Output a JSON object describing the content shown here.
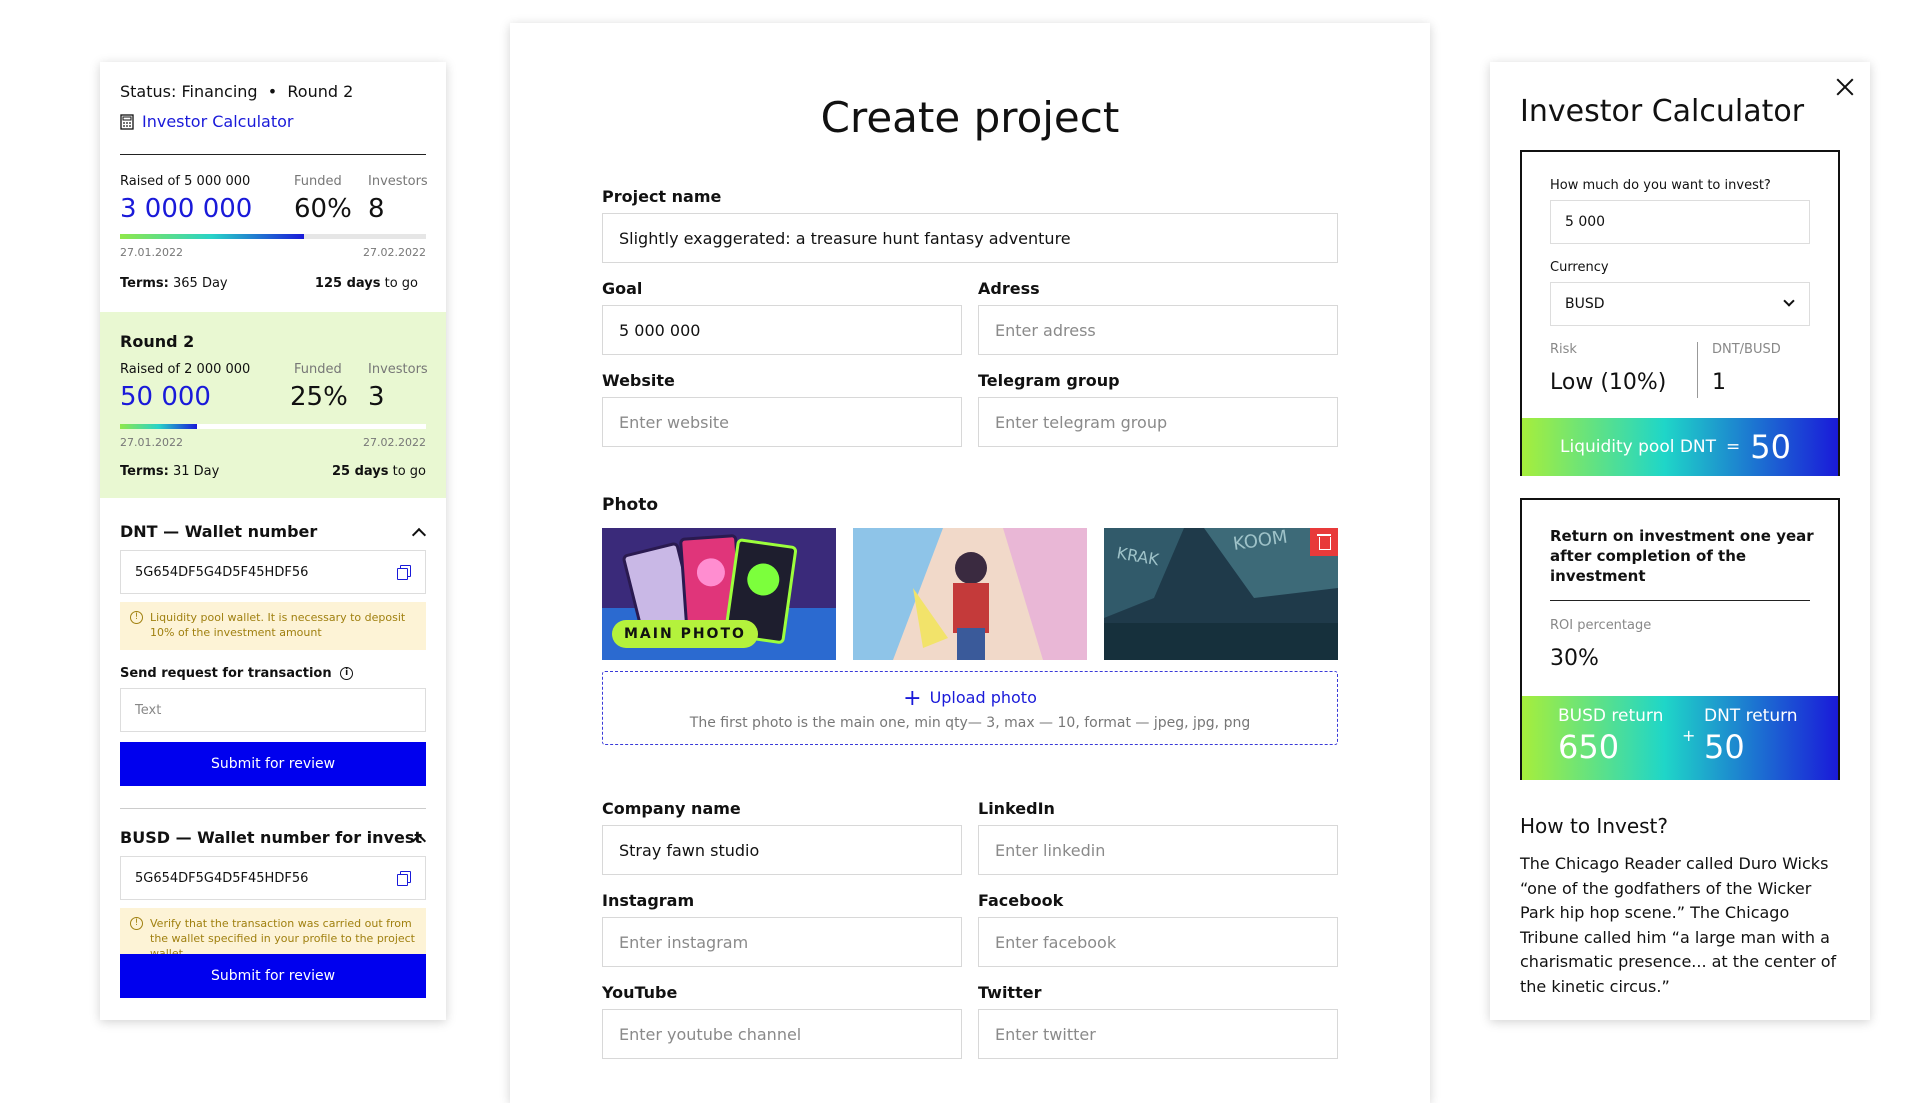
{
  "left": {
    "status_label": "Status:",
    "status_value": "Financing",
    "round_label": "Round 2",
    "calculator_link": "Investor Calculator",
    "main": {
      "raised_prefix": "Raised of",
      "raised_goal": "5 000 000",
      "raised_value": "3 000 000",
      "funded_label": "Funded",
      "funded_value": "60%",
      "funded_fraction": 0.6,
      "investors_label": "Investors",
      "investors_value": "8",
      "date_start": "27.01.2022",
      "date_end": "27.02.2022",
      "terms_label": "Terms:",
      "terms_value": "365 Day",
      "days_count": "125 days",
      "days_suffix": "to go"
    },
    "round2": {
      "title": "Round 2",
      "raised_prefix": "Raised of",
      "raised_goal": "2 000 000",
      "raised_value": "50 000",
      "funded_label": "Funded",
      "funded_value": "25%",
      "funded_fraction": 0.25,
      "investors_label": "Investors",
      "investors_value": "3",
      "date_start": "27.01.2022",
      "date_end": "27.02.2022",
      "terms_label": "Terms:",
      "terms_value": "31 Day",
      "days_count": "25 days",
      "days_suffix": "to go"
    },
    "dnt_section": {
      "title": "DNT — Wallet number",
      "wallet": "5G654DF5G4D5F45HDF56",
      "note": "Liquidity pool wallet. It is necessary to deposit 10% of the investment amount",
      "request_label": "Send request for transaction",
      "request_placeholder": "Text",
      "submit": "Submit for review"
    },
    "busd_section": {
      "title": "BUSD — Wallet number for invest",
      "wallet": "5G654DF5G4D5F45HDF56",
      "note": "Verify that the transaction was carried out from the wallet specified in your profile to the project wallet",
      "submit": "Submit for review"
    }
  },
  "center": {
    "title": "Create project",
    "project_name_label": "Project name",
    "project_name_value": "Slightly exaggerated: a treasure hunt fantasy adventure",
    "goal_label": "Goal",
    "goal_value": "5 000 000",
    "address_label": "Adress",
    "address_placeholder": "Enter adress",
    "website_label": "Website",
    "website_placeholder": "Enter website",
    "telegram_label": "Telegram group",
    "telegram_placeholder": "Enter telegram group",
    "photo_label": "Photo",
    "main_photo_badge": "MAIN PHOTO",
    "upload_label": "Upload photo",
    "upload_hint": "The first photo is the main one, min qty— 3, max — 10, format — jpeg, jpg, png",
    "company_label": "Company name",
    "company_value": "Stray fawn studio",
    "linkedin_label": "LinkedIn",
    "linkedin_placeholder": "Enter linkedin",
    "instagram_label": "Instagram",
    "instagram_placeholder": "Enter instagram",
    "facebook_label": "Facebook",
    "facebook_placeholder": "Enter facebook",
    "youtube_label": "YouTube",
    "youtube_placeholder": "Enter youtube channel",
    "twitter_label": "Twitter",
    "twitter_placeholder": "Enter twitter"
  },
  "right": {
    "title": "Investor Calculator",
    "invest_question": "How much do you want to invest?",
    "invest_value": "5 000",
    "currency_label": "Currency",
    "currency_value": "BUSD",
    "risk_label": "Risk",
    "risk_value": "Low (10%)",
    "ratio_label": "DNT/BUSD",
    "ratio_value": "1",
    "pool_label": "Liquidity pool DNT",
    "pool_eq": "=",
    "pool_value": "50",
    "roi_title": "Return on investment one year after completion of the investment",
    "roi_label": "ROI percentage",
    "roi_value": "30%",
    "busd_return_label": "BUSD return",
    "busd_return_value": "650",
    "plus": "+",
    "dnt_return_label": "DNT return",
    "dnt_return_value": "50",
    "how_title": "How to Invest?",
    "how_body": "The Chicago Reader called Duro Wicks “one of the godfathers of the Wicker Park hip hop scene.” The Chicago Tribune called him “a large man with a charismatic presence... at the center of the kinetic circus.”"
  }
}
